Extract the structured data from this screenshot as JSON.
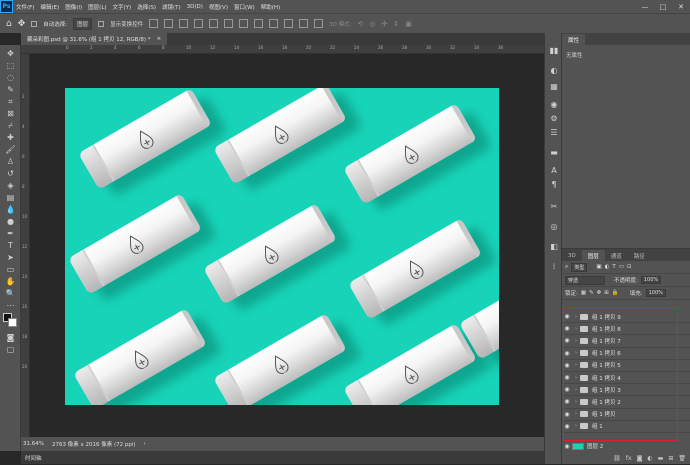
{
  "menubar": {
    "logo": "Ps",
    "items": [
      "文件(F)",
      "编辑(E)",
      "图像(I)",
      "图层(L)",
      "文字(Y)",
      "选择(S)",
      "滤镜(T)",
      "3D(D)",
      "视图(V)",
      "窗口(W)",
      "帮助(H)"
    ],
    "minimize": "—",
    "maximize": "□",
    "close": "✕"
  },
  "options": {
    "auto_select_label": "自动选择:",
    "auto_select_value": "图层",
    "show_transform_label": "显示变换控件",
    "mode_3d_label": "3D 模式:"
  },
  "document": {
    "tab_title": "藏朵彩图.psd @ 31.6% (组 1 拷贝 12, RGB/8) *",
    "tab_close": "×"
  },
  "status": {
    "zoom": "31.64%",
    "doc_size": "2763 像素 x 2016 像素 (72 ppi)",
    "arrow": "›"
  },
  "timeline": {
    "label": "时间轴"
  },
  "properties": {
    "tab_label": "属性",
    "empty_text": "无属性"
  },
  "layers_panel": {
    "tabs": [
      "3D",
      "图层",
      "通道",
      "路径"
    ],
    "filter_kind": "类型",
    "blend_mode": "穿透",
    "opacity_label": "不透明度:",
    "opacity_value": "100%",
    "lock_label": "锁定:",
    "fill_label": "填充:",
    "fill_value": "100%",
    "layers": [
      "组 1 拷贝 9",
      "组 1 拷贝 8",
      "组 1 拷贝 7",
      "组 1 拷贝 6",
      "组 1 拷贝 5",
      "组 1 拷贝 4",
      "组 1 拷贝 3",
      "组 1 拷贝 2",
      "组 1 拷贝",
      "组 1"
    ],
    "background_layer": "图层 2"
  },
  "ruler": {
    "top_ticks": [
      "0",
      "2",
      "4",
      "6",
      "8",
      "10",
      "12",
      "14",
      "16",
      "18",
      "20",
      "22",
      "24",
      "26",
      "28",
      "30",
      "32",
      "34",
      "36"
    ],
    "left_ticks": [
      "2",
      "4",
      "6",
      "8",
      "10",
      "12",
      "14",
      "16",
      "18",
      "20"
    ]
  },
  "colors": {
    "artwork_bg": "#17d4b8",
    "highlight": "#e02020",
    "chrome": "#535353"
  }
}
